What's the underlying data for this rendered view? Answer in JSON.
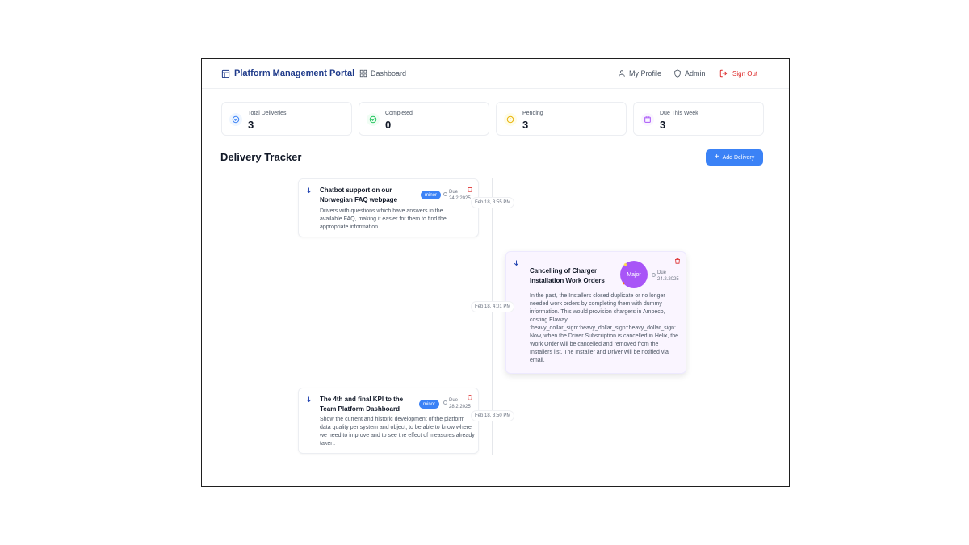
{
  "header": {
    "brand": "Platform Management Portal",
    "dashboard": "Dashboard",
    "profile": "My Profile",
    "admin": "Admin",
    "signout": "Sign Out"
  },
  "stats": [
    {
      "label": "Total Deliveries",
      "value": "3",
      "color": "#3b82f6",
      "bg": "#eff6ff",
      "icon": "check-circle-icon"
    },
    {
      "label": "Completed",
      "value": "0",
      "color": "#22c55e",
      "bg": "#f0fdf4",
      "icon": "check-circle-icon"
    },
    {
      "label": "Pending",
      "value": "3",
      "color": "#eab308",
      "bg": "#fefce8",
      "icon": "alert-circle-icon"
    },
    {
      "label": "Due This Week",
      "value": "3",
      "color": "#a855f7",
      "bg": "#faf5ff",
      "icon": "calendar-icon"
    }
  ],
  "tracker": {
    "title": "Delivery Tracker",
    "add_label": "Add Delivery",
    "items": [
      {
        "title": "Chatbot support on our Norwegian FAQ webpage",
        "badge": "minor",
        "due_label": "Due",
        "due_date": "24.2.2025",
        "timestamp": "Feb 18, 3:55 PM",
        "description": "Drivers with questions which have answers in the available FAQ, making it easier for them to find the appropriate information"
      },
      {
        "title": "Cancelling of Charger Installation Work Orders",
        "badge": "Major",
        "due_label": "Due",
        "due_date": "24.2.2025",
        "timestamp": "Feb 18, 4:01 PM",
        "description": "In the past, the Installers closed duplicate or no longer needed work orders by completing them with dummy information. This would provision chargers in Ampeco, costing Elaway :heavy_dollar_sign::heavy_dollar_sign::heavy_dollar_sign: Now, when the Driver Subscription is cancelled in Helix, the Work Order will be cancelled and removed from the Installers list. The Installer and Driver will be notified via email."
      },
      {
        "title": "The 4th and final KPI to the Team Platform Dashboard",
        "badge": "minor",
        "due_label": "Due",
        "due_date": "28.2.2025",
        "timestamp": "Feb 18, 3:50 PM",
        "description": "Show the current and historic development of the platform data quality per system and object, to be able to know where we need to improve and to see the effect of measures already taken."
      }
    ]
  },
  "colors": {
    "brand": "#1e3a8a",
    "accent": "#3b82f6",
    "danger": "#dc2626",
    "major": "#a855f7"
  }
}
